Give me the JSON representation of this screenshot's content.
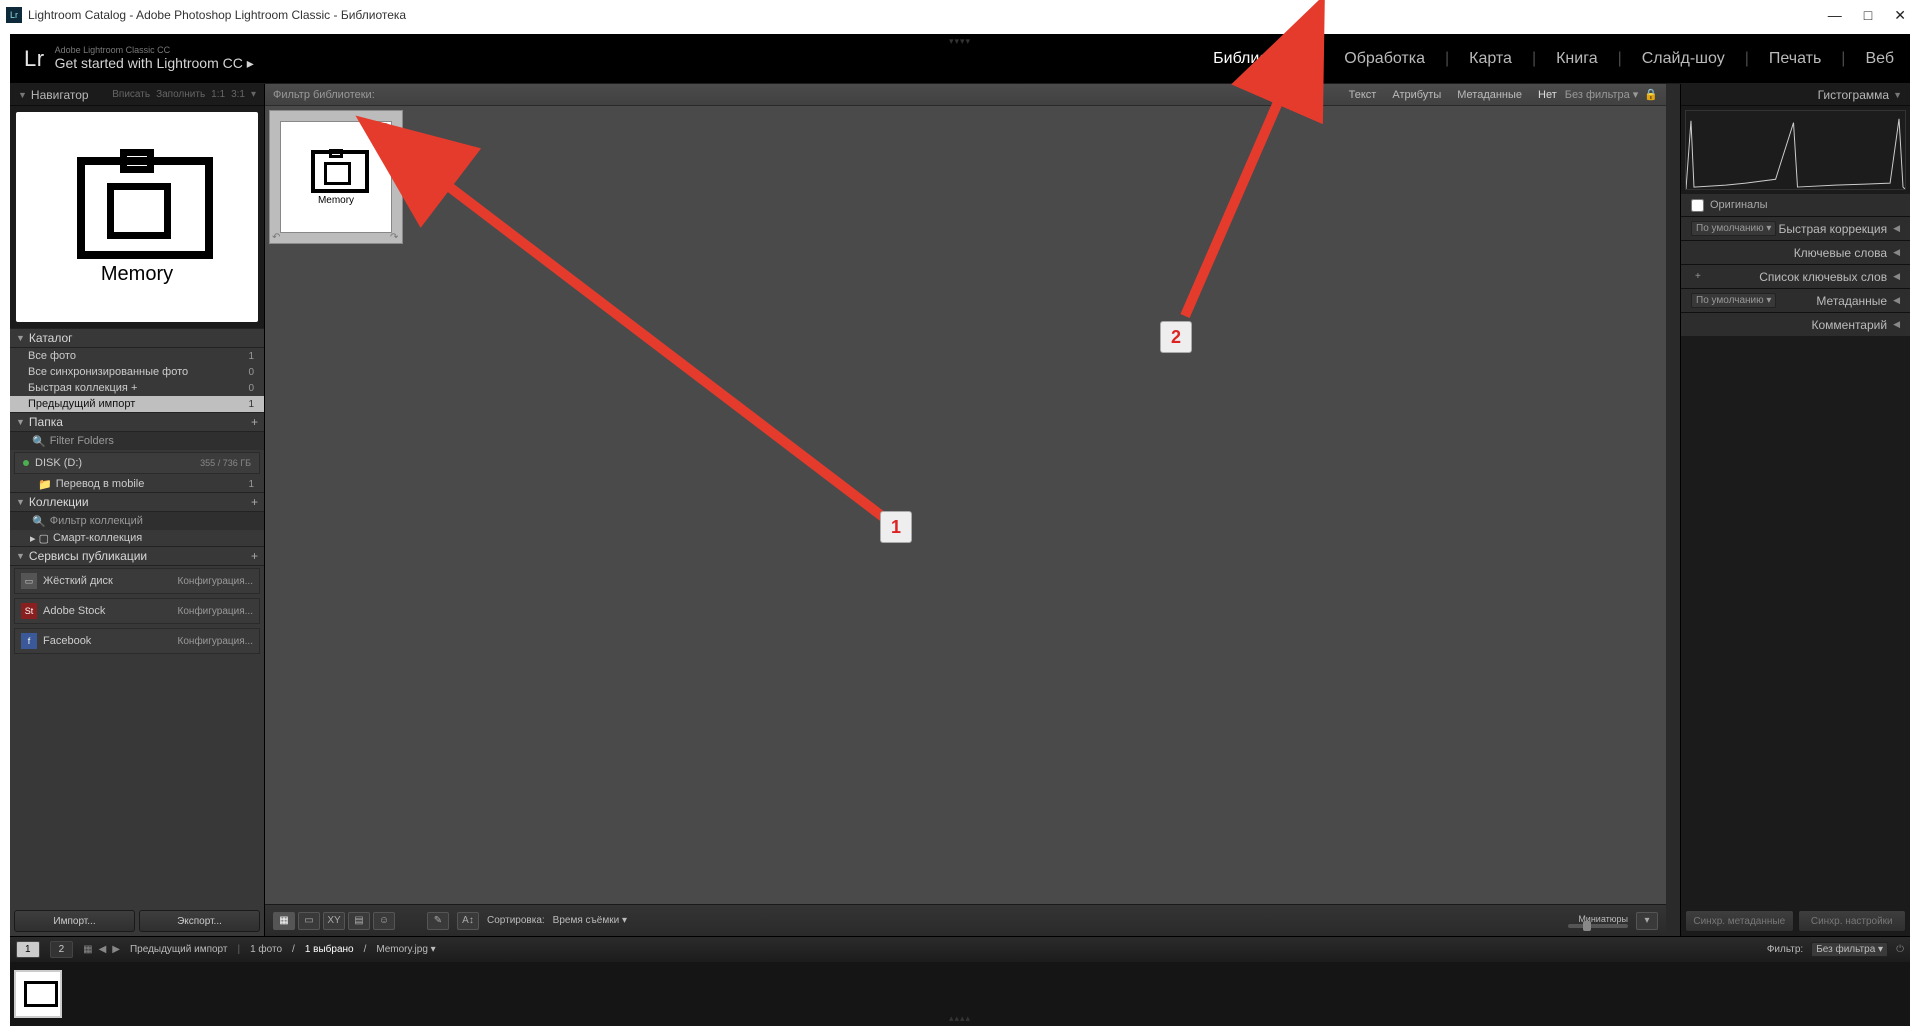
{
  "window": {
    "title": "Lightroom Catalog - Adobe Photoshop Lightroom Classic - Библиотека",
    "min": "—",
    "max": "□",
    "close": "✕"
  },
  "topbar": {
    "logo": "Lr",
    "brand_small": "Adobe Lightroom Classic CC",
    "brand": "Get started with Lightroom CC ▸",
    "modules": [
      "Библиотека",
      "Обработка",
      "Карта",
      "Книга",
      "Слайд-шоу",
      "Печать",
      "Веб"
    ],
    "active_module": 0
  },
  "navigator": {
    "title": "Навигатор",
    "opts": [
      "Вписать",
      "Заполнить",
      "1:1",
      "3:1"
    ],
    "preview_label": "Memory"
  },
  "catalog": {
    "title": "Каталог",
    "items": [
      {
        "label": "Все фото",
        "count": "1"
      },
      {
        "label": "Все синхронизированные фото",
        "count": "0"
      },
      {
        "label": "Быстрая коллекция  +",
        "count": "0"
      },
      {
        "label": "Предыдущий импорт",
        "count": "1",
        "selected": true
      }
    ]
  },
  "folders": {
    "title": "Папка",
    "filter": "Filter Folders",
    "drive": "DISK (D:)",
    "drive_space": "355 / 736 ГБ",
    "items": [
      {
        "label": "Перевод в mobile",
        "count": "1"
      }
    ]
  },
  "collections": {
    "title": "Коллекции",
    "filter": "Фильтр коллекций",
    "items": [
      {
        "label": "Смарт-коллекция"
      }
    ]
  },
  "publish": {
    "title": "Сервисы публикации",
    "services": [
      {
        "name": "Жёсткий диск",
        "config": "Конфигурация...",
        "icon": "hd",
        "bg": "#555"
      },
      {
        "name": "Adobe Stock",
        "config": "Конфигурация...",
        "icon": "St",
        "bg": "#8a1f1f"
      },
      {
        "name": "Facebook",
        "config": "Конфигурация...",
        "icon": "f",
        "bg": "#3b5998"
      }
    ]
  },
  "left_btns": {
    "import": "Импорт...",
    "export": "Экспорт..."
  },
  "filterbar": {
    "label": "Фильтр библиотеки:",
    "tabs": [
      "Текст",
      "Атрибуты",
      "Метаданные",
      "Нет"
    ],
    "active": 3,
    "right": "Без фильтра",
    "lock": "🔒"
  },
  "grid": {
    "thumb_label": "Memory"
  },
  "toolbar": {
    "sort_label": "Сортировка:",
    "sort_value": "Время съёмки",
    "thumbs_label": "Миниатюры"
  },
  "right_panel": {
    "histogram": "Гистограмма",
    "originals": "Оригиналы",
    "quick_preset": "По умолчанию",
    "rows": [
      "Быстрая коррекция",
      "Ключевые слова",
      "Список ключевых слов",
      "Метаданные",
      "Комментарий"
    ],
    "meta_preset": "По умолчанию",
    "keyword_plus": "+",
    "sync_meta": "Синхр. метаданные",
    "sync_settings": "Синхр. настройки"
  },
  "statusbar": {
    "views": [
      "1",
      "2"
    ],
    "source": "Предыдущий импорт",
    "count": "1 фото",
    "sel": "1 выбрано",
    "file": "Memory.jpg",
    "filter_label": "Фильтр:",
    "filter_value": "Без фильтра"
  },
  "annotations": {
    "a1": "1",
    "a2": "2"
  }
}
